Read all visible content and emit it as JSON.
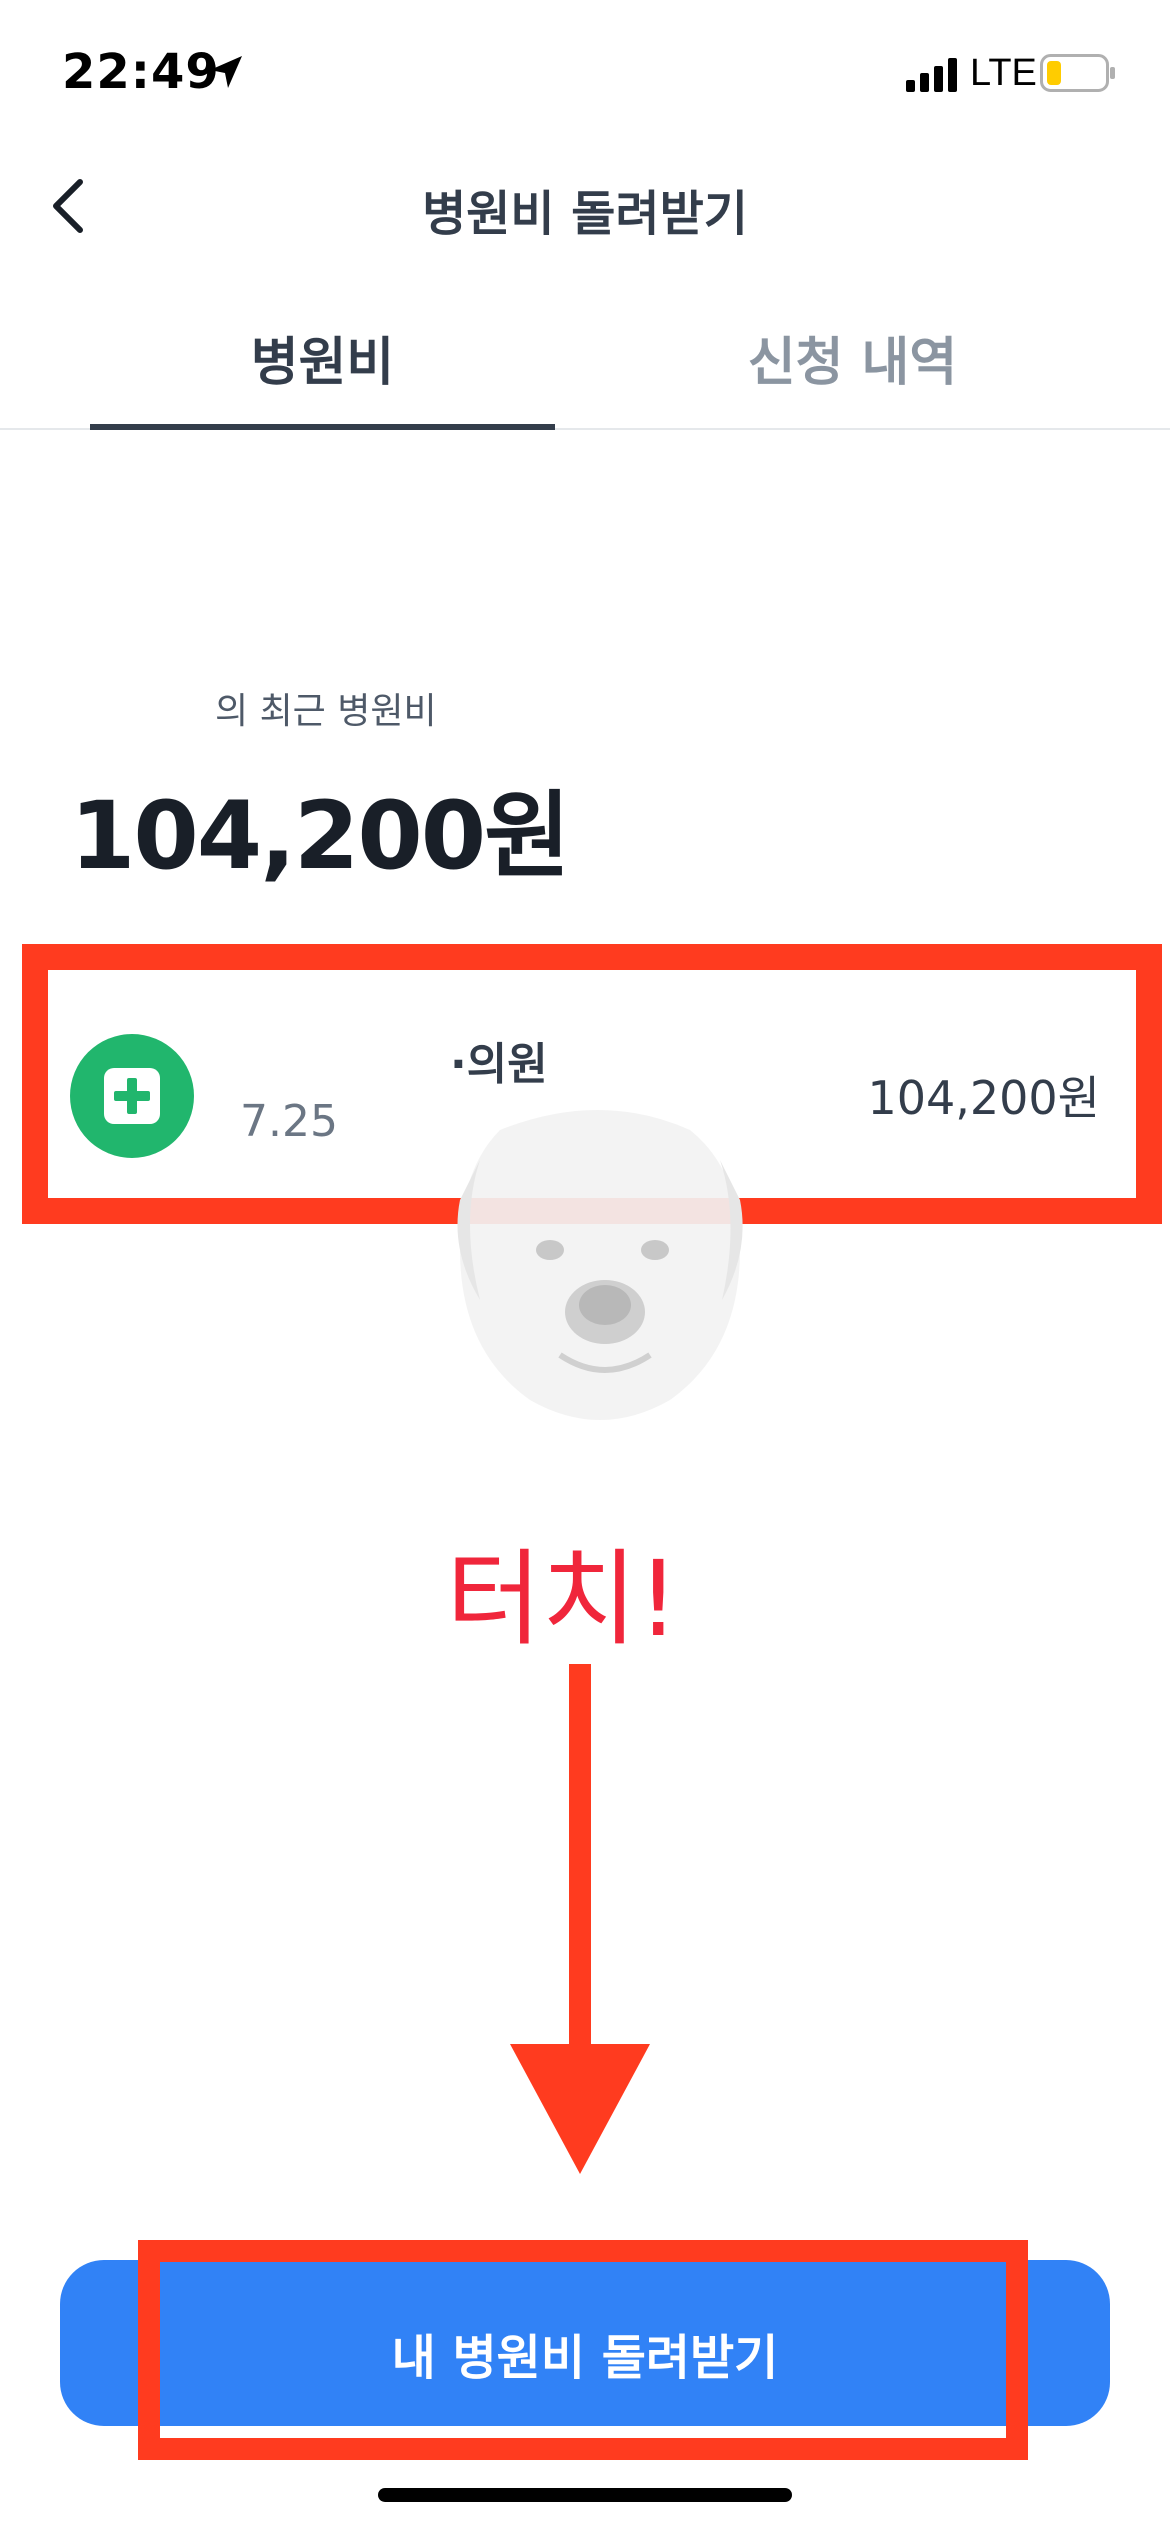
{
  "status_bar": {
    "time": "22:49",
    "network": "LTE"
  },
  "header": {
    "title": "병원비 돌려받기"
  },
  "tabs": [
    {
      "label": "병원비",
      "active": true
    },
    {
      "label": "신청 내역",
      "active": false
    }
  ],
  "summary": {
    "subtitle": "의 최근 병원비",
    "total": "104,200원"
  },
  "hospital_item": {
    "name": "·의원",
    "date": "7.25",
    "amount": "104,200원",
    "icon": "plus-icon"
  },
  "annotation": {
    "text": "터치!",
    "color": "#f0263b",
    "box_color": "#ff3b1f"
  },
  "cta": {
    "label": "내 병원비 돌려받기",
    "color": "#3182f6"
  },
  "colors": {
    "accent_green": "#21b66d",
    "text_dark": "#191f28",
    "text_gray": "#8b95a1"
  }
}
